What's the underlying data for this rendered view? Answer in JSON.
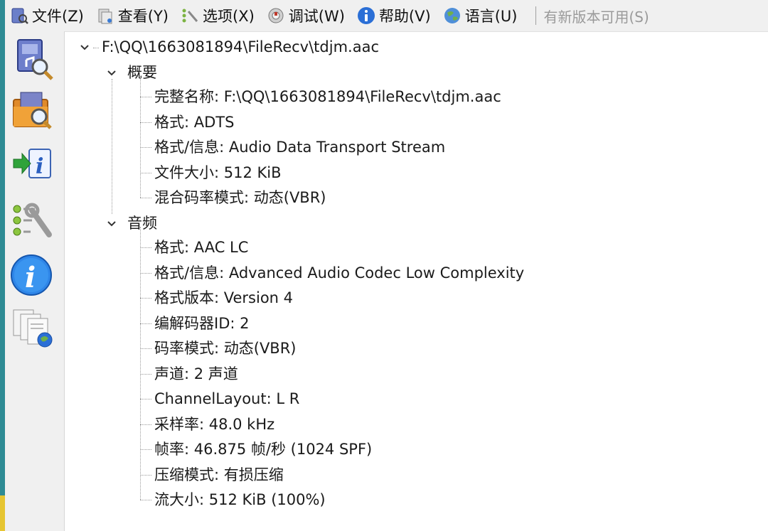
{
  "menu": {
    "file": "文件(Z)",
    "view": "查看(Y)",
    "options": "选项(X)",
    "debug": "调试(W)",
    "help": "帮助(V)",
    "language": "语言(U)",
    "update": "有新版本可用(S)"
  },
  "toolbar": {
    "icons": [
      "open-file-icon",
      "open-folder-icon",
      "export-info-icon",
      "preferences-icon",
      "about-icon",
      "sheets-web-icon"
    ]
  },
  "tree": {
    "root": "F:\\QQ\\1663081894\\FileRecv\\tdjm.aac",
    "general": {
      "label": "概要",
      "items": [
        "完整名称: F:\\QQ\\1663081894\\FileRecv\\tdjm.aac",
        "格式: ADTS",
        "格式/信息: Audio Data Transport Stream",
        "文件大小: 512 KiB",
        "混合码率模式: 动态(VBR)"
      ]
    },
    "audio": {
      "label": "音频",
      "items": [
        "格式: AAC LC",
        "格式/信息: Advanced Audio Codec Low Complexity",
        "格式版本: Version 4",
        "编解码器ID: 2",
        "码率模式: 动态(VBR)",
        "声道: 2 声道",
        "ChannelLayout: L R",
        "采样率: 48.0 kHz",
        "帧率: 46.875 帧/秒 (1024 SPF)",
        "压缩模式: 有损压缩",
        "流大小: 512 KiB (100%)"
      ]
    }
  },
  "colors": {
    "accent": "#2b6fd6",
    "strip": "#2e8b94"
  }
}
